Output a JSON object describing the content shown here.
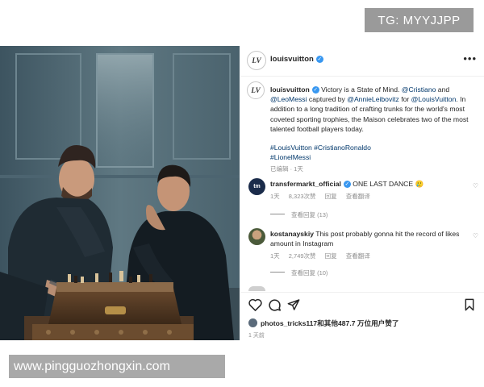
{
  "watermarks": {
    "top": "TG: MYYJJPP",
    "bottom": "www.pingguozhongxin.com"
  },
  "post": {
    "account": "louisvuitton",
    "caption": {
      "username": "louisvuitton",
      "text_1": "Victory is a State of Mind.",
      "mention_1": "@Cristiano",
      "text_2": "and",
      "mention_2": "@LeoMessi",
      "text_3": "captured by",
      "mention_3": "@AnnieLeibovitz",
      "text_4": "for",
      "mention_4": "@LouisVuitton",
      "text_5": ". In addition to a long tradition of crafting trunks for the world's most coveted sporting trophies, the Maison celebrates two of the most talented football players today.",
      "hashtags_line1": "#LouisVuitton #CristianoRonaldo",
      "hashtags_line2": "#LionelMessi",
      "meta": "已编辑 · 1天"
    },
    "comments": [
      {
        "username": "transfermarkt_official",
        "text": "ONE LAST DANCE 🥲",
        "time": "1天",
        "likes": "8,323次赞",
        "reply": "回复",
        "translate": "查看翻译",
        "replies": "查看回复 (13)",
        "avatar_label": "tm"
      },
      {
        "username": "kostanayskiy",
        "text": "This post probably gonna hit the record of likes amount in Instagram",
        "time": "1天",
        "likes": "2,749次赞",
        "reply": "回复",
        "translate": "查看翻译",
        "replies": "查看回复 (10)"
      }
    ],
    "liked_by": "photos_tricks117和其他487.7 万位用户赞了",
    "timestamp": "1 天前"
  },
  "icons": {
    "like": "heart-icon",
    "comment": "comment-icon",
    "share": "share-icon",
    "save": "bookmark-icon",
    "more": "more-icon",
    "verified": "verified-icon"
  },
  "colors": {
    "verified": "#3897f0",
    "link": "#00376b",
    "muted": "#8e8e8e",
    "text": "#262626"
  }
}
